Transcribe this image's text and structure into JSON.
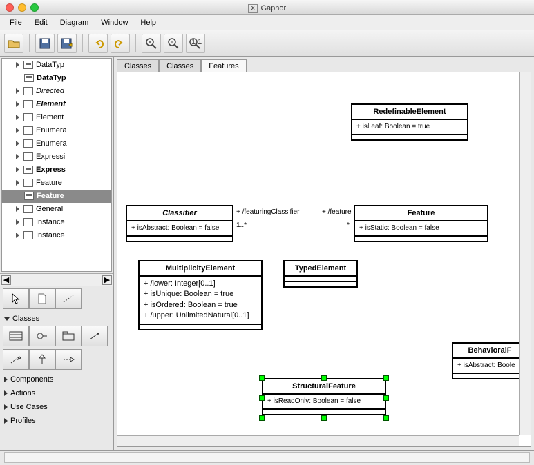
{
  "window": {
    "title": "Gaphor",
    "title_prefix": "X"
  },
  "menu": {
    "file": "File",
    "edit": "Edit",
    "diagram": "Diagram",
    "window": "Window",
    "help": "Help"
  },
  "tree": {
    "items": [
      {
        "label": "DataTyp",
        "exp": true,
        "sel": false,
        "icon": "b"
      },
      {
        "label": "DataTyp",
        "exp": false,
        "sel": false,
        "icon": "b",
        "bold": true
      },
      {
        "label": "Directed",
        "exp": true,
        "sel": false,
        "italic": true
      },
      {
        "label": "Element",
        "exp": true,
        "sel": false,
        "italic": true,
        "bold": true
      },
      {
        "label": "Element",
        "exp": true,
        "sel": false
      },
      {
        "label": "Enumera",
        "exp": true,
        "sel": false
      },
      {
        "label": "Enumera",
        "exp": true,
        "sel": false
      },
      {
        "label": "Expressi",
        "exp": true,
        "sel": false
      },
      {
        "label": "Express",
        "exp": true,
        "sel": false,
        "bold": true,
        "icon": "b"
      },
      {
        "label": "Feature",
        "exp": true,
        "sel": false
      },
      {
        "label": "Feature",
        "exp": false,
        "sel": true,
        "icon": "b",
        "bold": true
      },
      {
        "label": "General",
        "exp": true,
        "sel": false
      },
      {
        "label": "Instance",
        "exp": true,
        "sel": false
      },
      {
        "label": "Instance",
        "exp": true,
        "sel": false
      }
    ]
  },
  "palette": {
    "classes_header": "Classes",
    "components": "Components",
    "actions": "Actions",
    "usecases": "Use Cases",
    "profiles": "Profiles"
  },
  "tabs": [
    {
      "label": "Classes",
      "active": false
    },
    {
      "label": "Classes",
      "active": false
    },
    {
      "label": "Features",
      "active": true
    }
  ],
  "uml": {
    "redefinable": {
      "name": "RedefinableElement",
      "attr": "+ isLeaf: Boolean = true"
    },
    "classifier": {
      "name": "Classifier",
      "attr": "+ isAbstract: Boolean = false"
    },
    "feature": {
      "name": "Feature",
      "attr": "+ isStatic: Boolean = false"
    },
    "multiplicity": {
      "name": "MultiplicityElement",
      "a1": "+ /lower: Integer[0..1]",
      "a2": "+ isUnique: Boolean = true",
      "a3": "+ isOrdered: Boolean = true",
      "a4": "+ /upper: UnlimitedNatural[0..1]"
    },
    "typed": {
      "name": "TypedElement"
    },
    "structural": {
      "name": "StructuralFeature",
      "attr": "+ isReadOnly: Boolean = false"
    },
    "behavioral": {
      "name": "BehavioralF",
      "attr": "+ isAbstract: Boole"
    },
    "assoc": {
      "left": "+ /featuringClassifier",
      "right": "+ /feature",
      "lcard": "1..*",
      "rcard": "*"
    }
  }
}
